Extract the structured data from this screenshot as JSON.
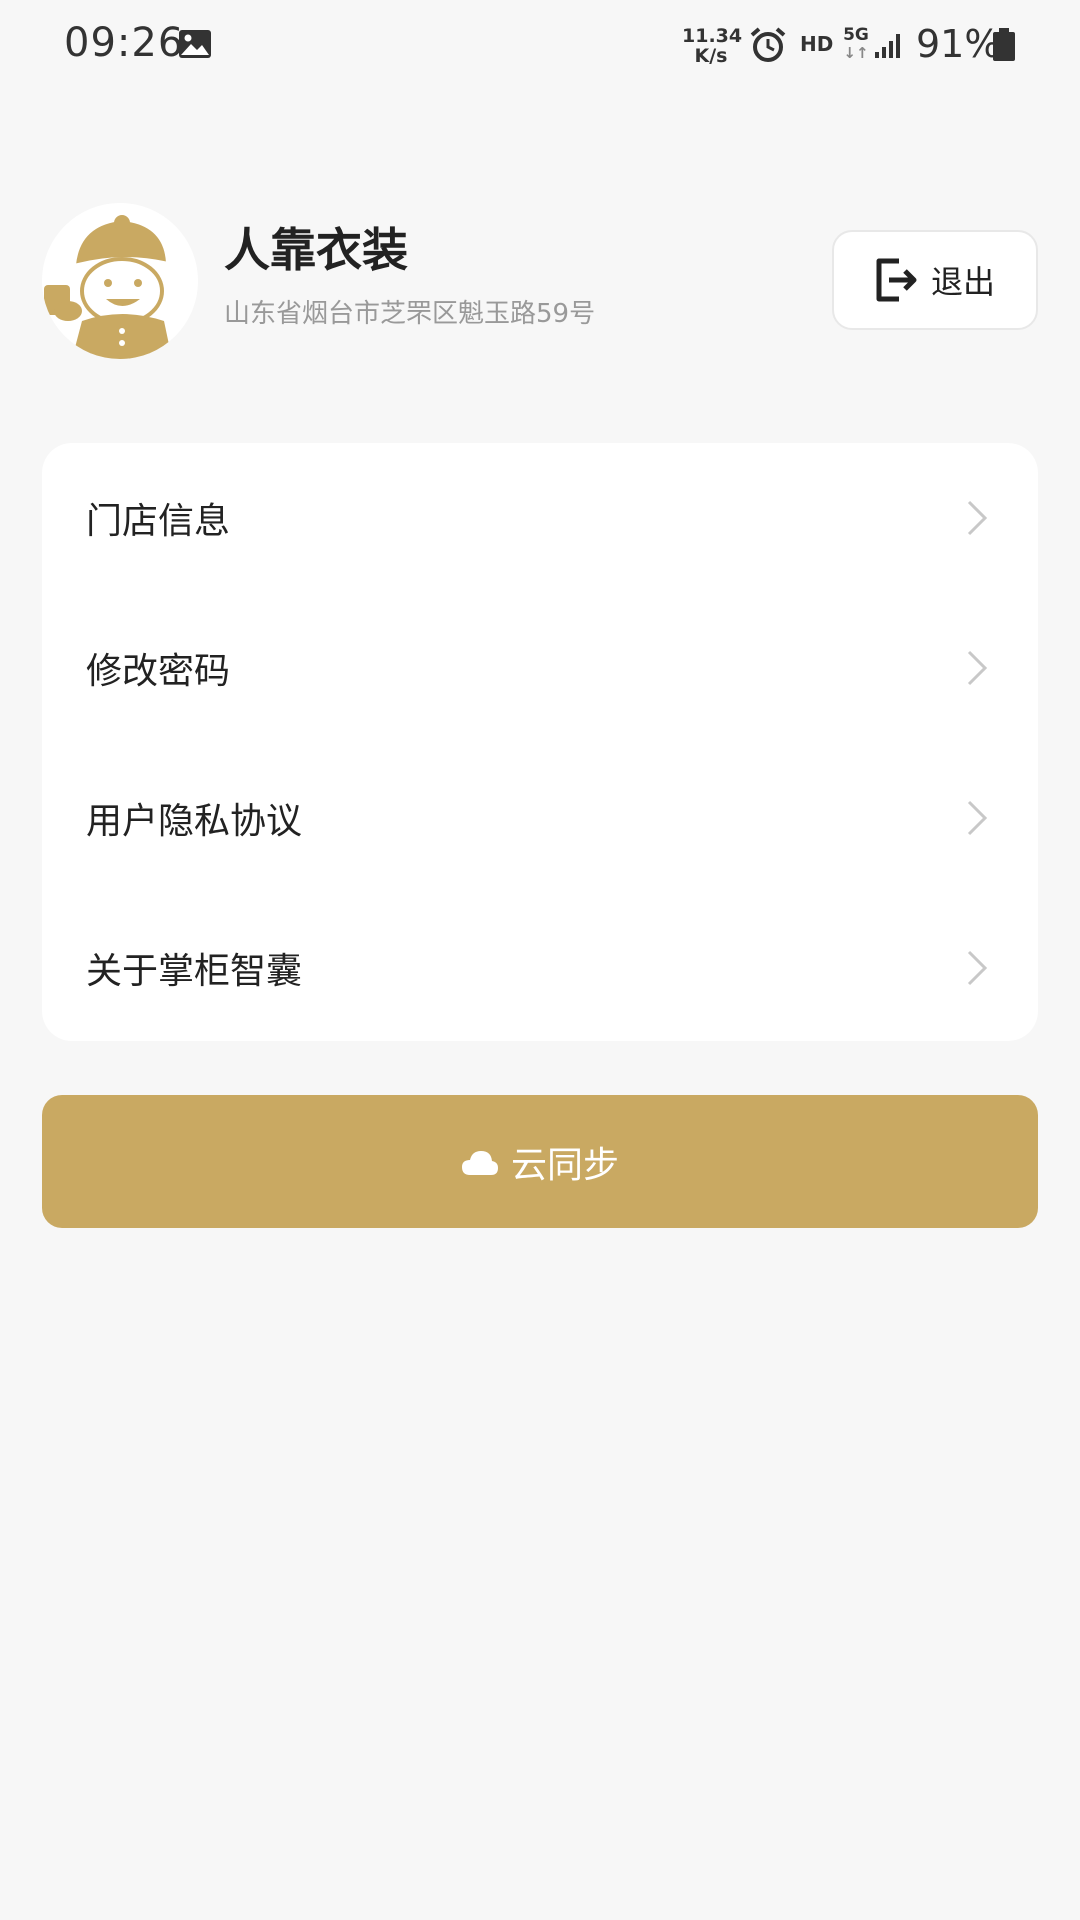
{
  "status_bar": {
    "time": "09:26",
    "speed_value": "11.34",
    "speed_unit": "K/s",
    "hd": "HD",
    "network": "5G",
    "network_arrows": "↓↑",
    "battery": "91%"
  },
  "profile": {
    "store_name": "人靠衣装",
    "address": "山东省烟台市芝罘区魁玉路59号",
    "avatar_icon": "mascot-avatar-icon"
  },
  "logout": {
    "label": "退出",
    "icon": "logout-icon"
  },
  "menu": {
    "items": [
      {
        "label": "门店信息"
      },
      {
        "label": "修改密码"
      },
      {
        "label": "用户隐私协议"
      },
      {
        "label": "关于掌柜智囊"
      }
    ]
  },
  "sync": {
    "label": "云同步",
    "icon": "cloud-icon"
  },
  "colors": {
    "accent": "#c9a962",
    "background": "#f7f7f7"
  }
}
